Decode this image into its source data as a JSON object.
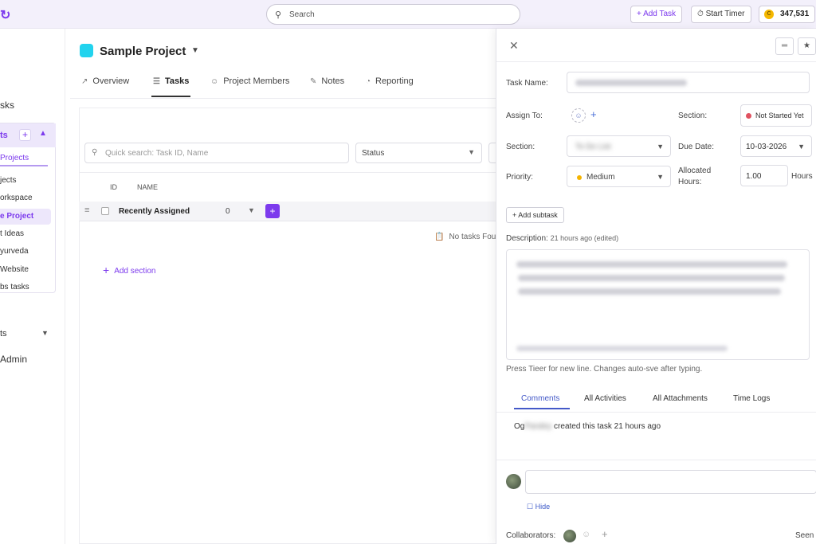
{
  "topbar": {
    "search_placeholder": "Search",
    "add_task": "Add Task",
    "start_timer": "Start Timer",
    "coins": "347,531"
  },
  "leftnav": {
    "tasks_heading": "sks",
    "projects_label": "ts",
    "projects_tab": "Projects",
    "items": [
      {
        "label": "jects"
      },
      {
        "label": "orkspace"
      },
      {
        "label": "e Project"
      },
      {
        "label": "t Ideas"
      },
      {
        "label": "yurveda"
      },
      {
        "label": "Website"
      },
      {
        "label": "bs tasks"
      }
    ],
    "section2": "ts",
    "admin": "Admin"
  },
  "project": {
    "title": "Sample Project",
    "tabs": [
      {
        "label": "Overview",
        "icon": "chart-icon"
      },
      {
        "label": "Tasks",
        "icon": "clipboard-icon"
      },
      {
        "label": "Project Members",
        "icon": "users-icon"
      },
      {
        "label": "Notes",
        "icon": "note-icon"
      },
      {
        "label": "Reporting",
        "icon": "report-icon"
      }
    ],
    "quick_search_placeholder": "Quick search: Task ID, Name",
    "status_filter": "Status",
    "columns": {
      "id": "ID",
      "name": "NAME"
    },
    "group": {
      "name": "Recently Assigned",
      "count": "0"
    },
    "no_tasks": "No tasks Fou",
    "add_section": "Add section"
  },
  "panel": {
    "task_name_label": "Task Name:",
    "assign_label": "Assign To:",
    "section_label_right": "Section:",
    "status": "Not Started Yet",
    "section_label": "Section:",
    "section_value": "To Do List",
    "due_date_label": "Due Date:",
    "due_date": "10-03-2026",
    "priority_label": "Priority:",
    "priority": "Medium",
    "allocated_label_1": "Allocated",
    "allocated_label_2": "Hours:",
    "allocated_value": "1.00",
    "hours_unit": "Hours",
    "add_subtask": "Add subtask",
    "description_label": "Description:",
    "description_meta": "21 hours ago (edited)",
    "hint": "Press  Tieer  for new line. Changes auto-sve after typing.",
    "tabs": [
      "Comments",
      "All Activities",
      "All Attachments",
      "Time Logs"
    ],
    "activity_prefix": "Og",
    "activity_name": "Pandey",
    "activity_text": "created this task 21 hours ago",
    "hide": "Hide",
    "collaborators": "Collaborators:",
    "seen": "Seen"
  },
  "colors": {
    "accent": "#7c3aed",
    "project": "#22d3ee",
    "status_red": "#e05260",
    "priority": "#f5b400",
    "link": "#4459c8"
  }
}
